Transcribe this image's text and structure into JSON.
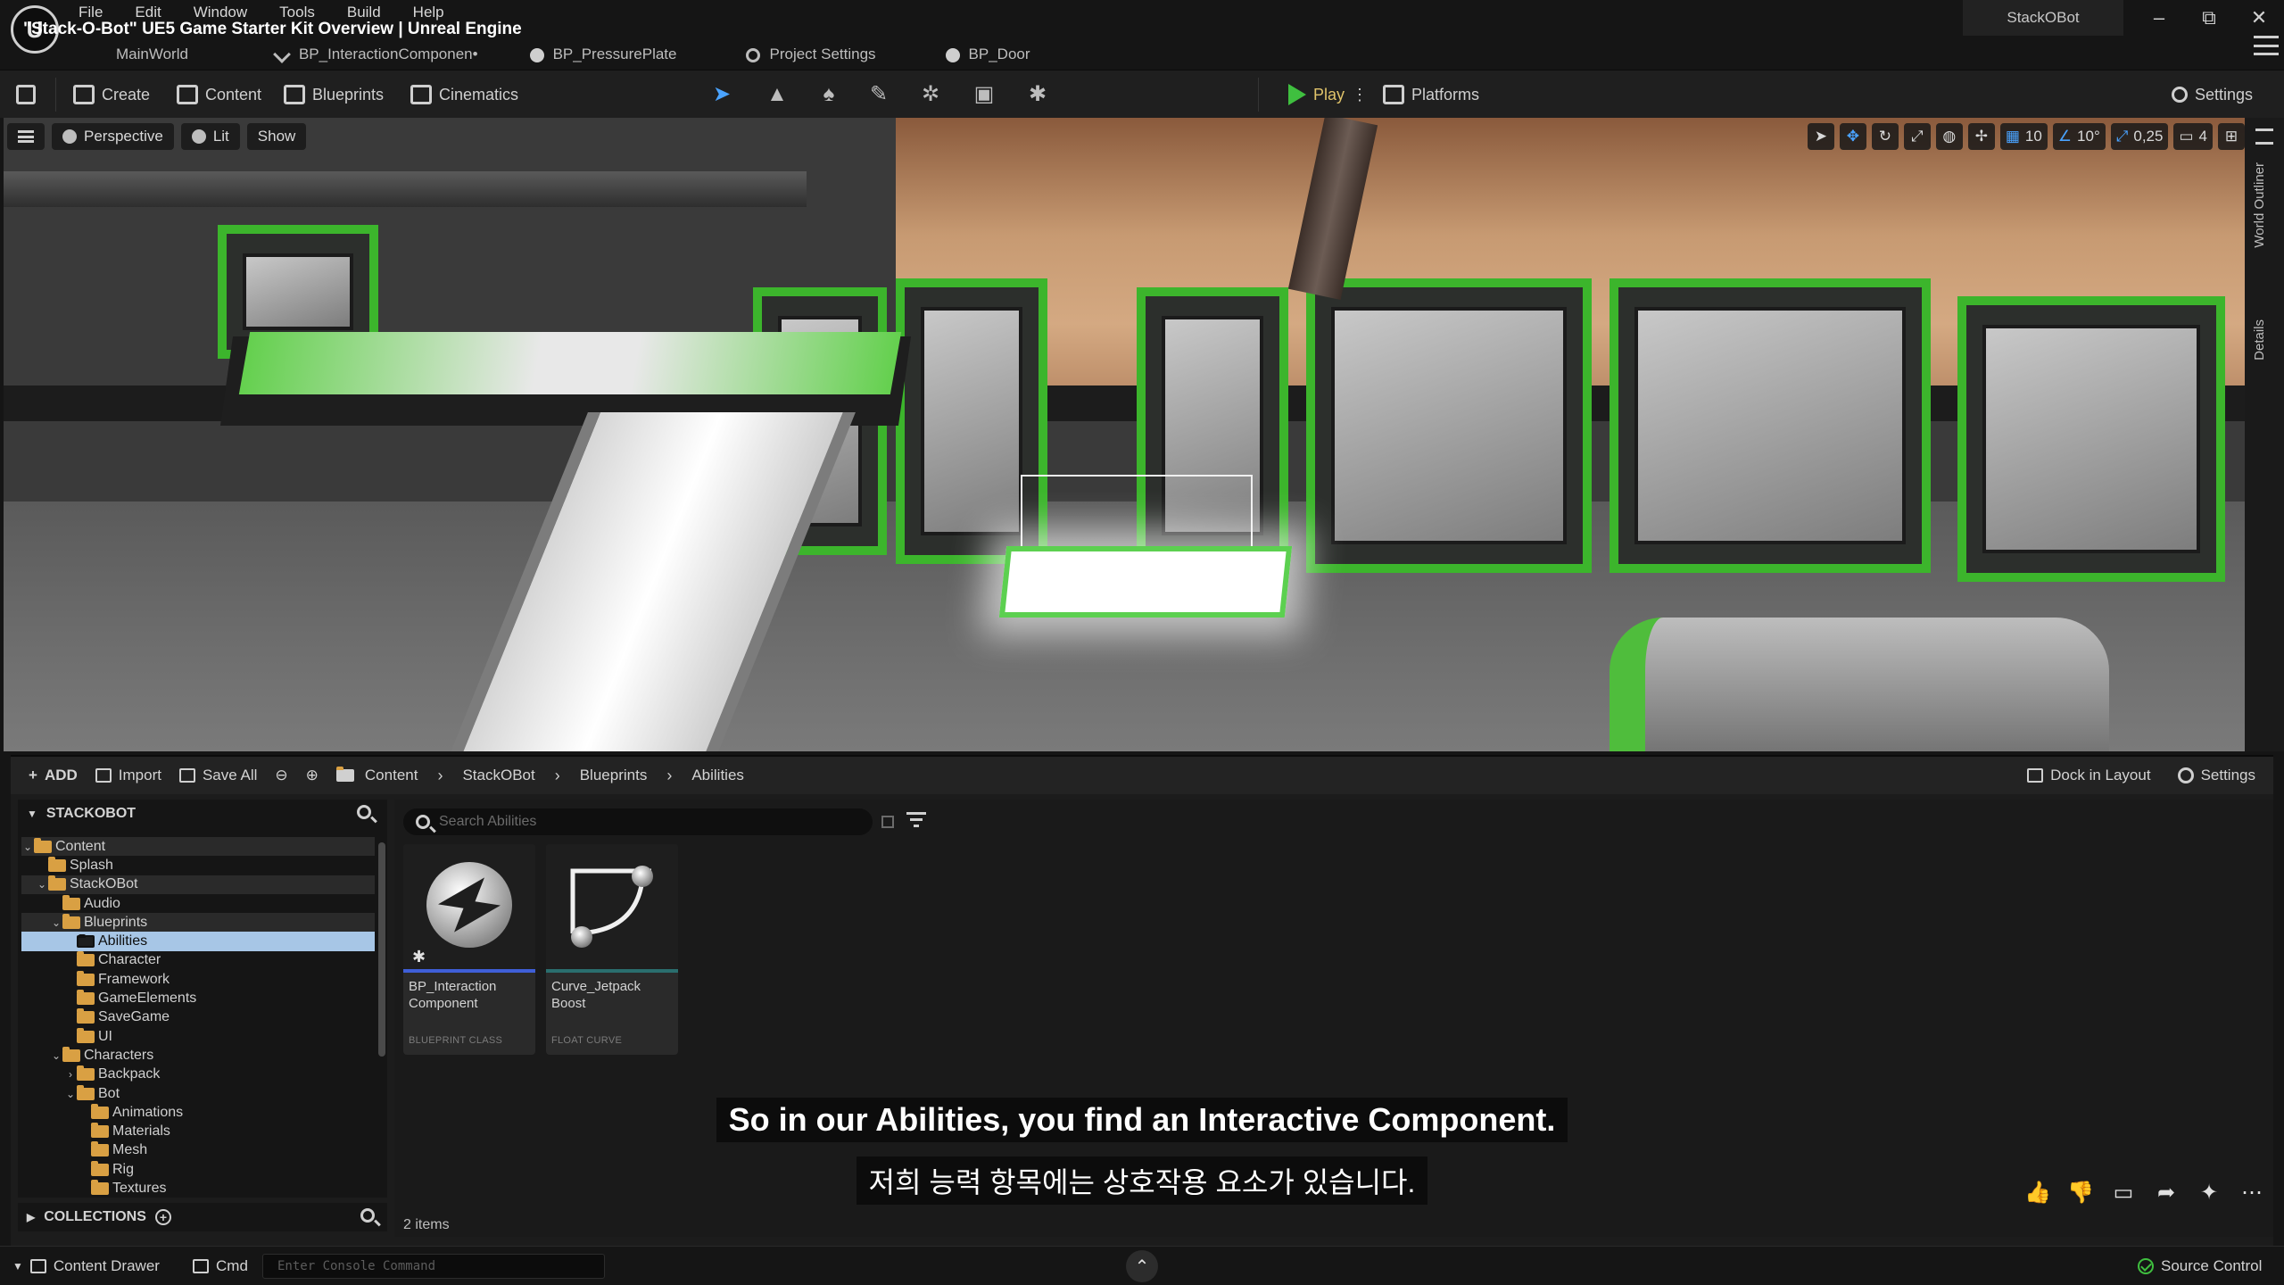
{
  "window": {
    "title": "\"Stack-O-Bot\" UE5 Game Starter Kit Overview | Unreal Engine",
    "project_name": "StackOBot",
    "logo_letter": "U",
    "controls": [
      "–",
      "⧉",
      "✕"
    ]
  },
  "menu": [
    "File",
    "Edit",
    "Window",
    "Tools",
    "Build",
    "Help"
  ],
  "tabs": [
    {
      "label": "MainWorld"
    },
    {
      "label": "BP_InteractionComponen•"
    },
    {
      "label": "BP_PressurePlate"
    },
    {
      "label": "Project Settings"
    },
    {
      "label": "BP_Door"
    }
  ],
  "toolbar": {
    "create": "Create",
    "content": "Content",
    "blueprints": "Blueprints",
    "cinematics": "Cinematics",
    "play": "Play",
    "platforms": "Platforms",
    "settings": "Settings",
    "more": "⋮"
  },
  "viewport": {
    "perspective": "Perspective",
    "lit": "Lit",
    "show": "Show",
    "grid_snap": "10",
    "rotation_snap": "10°",
    "scale_snap": "0,25",
    "camera_speed": "4"
  },
  "side_tabs": {
    "world_outliner": "World Outliner",
    "details": "Details"
  },
  "content_browser": {
    "add": "ADD",
    "import": "Import",
    "save_all": "Save All",
    "breadcrumb": [
      "Content",
      "StackOBot",
      "Blueprints",
      "Abilities"
    ],
    "dock_in_layout": "Dock in Layout",
    "settings": "Settings",
    "tree_header": "STACKOBOT",
    "collections": "COLLECTIONS",
    "search_placeholder": "Search Abilities",
    "items_count": "2 items",
    "tree": [
      {
        "label": "Content",
        "depth": 0,
        "expanded": true
      },
      {
        "label": "Splash",
        "depth": 1
      },
      {
        "label": "StackOBot",
        "depth": 1,
        "expanded": true
      },
      {
        "label": "Audio",
        "depth": 2
      },
      {
        "label": "Blueprints",
        "depth": 2,
        "expanded": true
      },
      {
        "label": "Abilities",
        "depth": 3,
        "selected": true
      },
      {
        "label": "Character",
        "depth": 3
      },
      {
        "label": "Framework",
        "depth": 3
      },
      {
        "label": "GameElements",
        "depth": 3
      },
      {
        "label": "SaveGame",
        "depth": 3
      },
      {
        "label": "UI",
        "depth": 3
      },
      {
        "label": "Characters",
        "depth": 2,
        "expanded": true
      },
      {
        "label": "Backpack",
        "depth": 3,
        "collapsed": true
      },
      {
        "label": "Bot",
        "depth": 3,
        "expanded": true
      },
      {
        "label": "Animations",
        "depth": 4
      },
      {
        "label": "Materials",
        "depth": 4
      },
      {
        "label": "Mesh",
        "depth": 4
      },
      {
        "label": "Rig",
        "depth": 4
      },
      {
        "label": "Textures",
        "depth": 4
      }
    ],
    "assets": [
      {
        "name": "BP_Interaction Component",
        "type": "BLUEPRINT CLASS",
        "strip_color": "#3f5fd8",
        "icon": "blueprint-component-icon"
      },
      {
        "name": "Curve_Jetpack Boost",
        "type": "FLOAT CURVE",
        "strip_color": "#2a6e6e",
        "icon": "float-curve-icon"
      }
    ]
  },
  "subtitles": {
    "en": "So in our Abilities, you find an Interactive Component.",
    "ko": "저희 능력 항목에는 상호작용 요소가 있습니다."
  },
  "reactions": [
    "👍",
    "👎",
    "▭",
    "➦",
    "✦",
    "⋯"
  ],
  "statusbar": {
    "content_drawer": "Content Drawer",
    "cmd": "Cmd",
    "console_placeholder": "Enter Console Command",
    "source_control": "Source Control"
  },
  "colors": {
    "accent_green": "#3fbf3f",
    "selection_blue": "#a7c6e6",
    "folder": "#d9a043",
    "blueprint_strip": "#3f5fd8",
    "curve_strip": "#2a6e6e"
  }
}
